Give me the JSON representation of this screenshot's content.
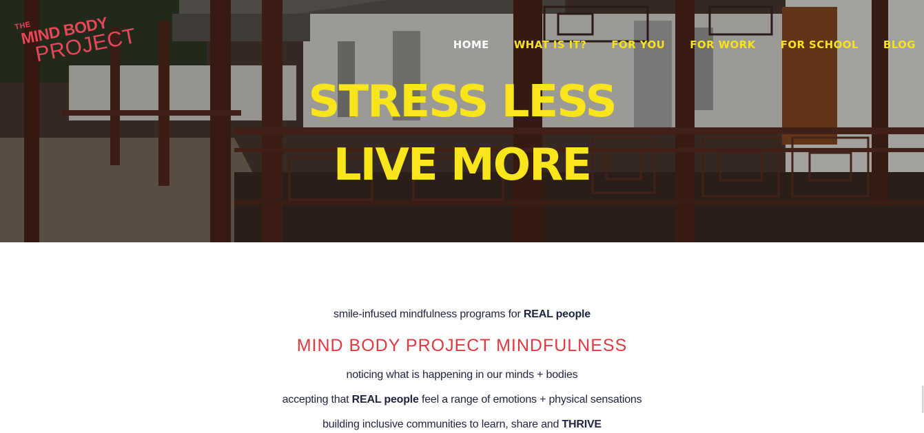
{
  "logo": {
    "the": "THE",
    "mind_body": "MIND BODY",
    "project": "PROJECT",
    "color": "#e8475a"
  },
  "nav": {
    "items": [
      {
        "label": "HOME",
        "active": true
      },
      {
        "label": "WHAT IS IT?",
        "active": false
      },
      {
        "label": "FOR YOU",
        "active": false
      },
      {
        "label": "FOR WORK",
        "active": false
      },
      {
        "label": "FOR SCHOOL",
        "active": false
      },
      {
        "label": "BLOG",
        "active": false
      }
    ],
    "active_color": "#ffffff",
    "color": "#f6e31e"
  },
  "hero": {
    "line1": "STRESS LESS",
    "line2": "LIVE MORE",
    "headline_color": "#f9e51b"
  },
  "content": {
    "tagline_pre": "smile-infused mindfulness programs for ",
    "tagline_bold": "REAL people",
    "title": "MIND BODY PROJECT MINDFULNESS",
    "title_color": "#e0393e",
    "p1": "noticing what is happening in our minds + bodies",
    "p2_pre": "accepting that ",
    "p2_bold": "REAL people",
    "p2_post": " feel a range of emotions + physical sensations",
    "p3_pre": "building inclusive communities to learn, share and ",
    "p3_bold": "THRIVE"
  }
}
